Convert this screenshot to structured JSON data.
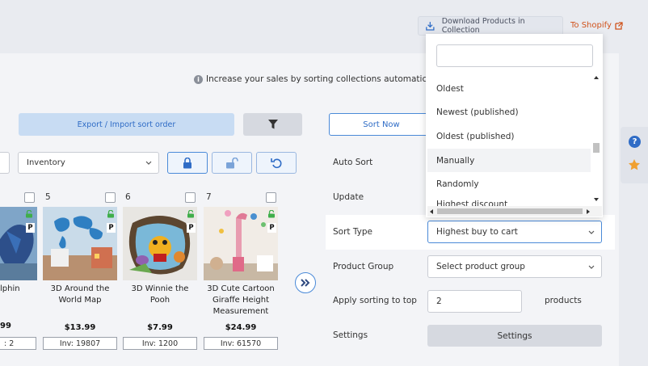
{
  "header": {
    "download_label": "Download Products in Collection",
    "shopify_label": "To Shopify"
  },
  "info_text": "Increase your sales by sorting collections automatically b",
  "toolbar": {
    "export_label": "Export / Import sort order",
    "sort_now_label": "Sort Now",
    "inventory_select": "Inventory"
  },
  "products": [
    {
      "num": "",
      "name_lines": [
        "lphin"
      ],
      "price": "99",
      "inv": ": 2"
    },
    {
      "num": "5",
      "name_lines": [
        "3D Around the",
        "World Map"
      ],
      "price": "$13.99",
      "inv": "Inv: 19807"
    },
    {
      "num": "6",
      "name_lines": [
        "3D Winnie the",
        "Pooh"
      ],
      "price": "$7.99",
      "inv": "Inv: 1200"
    },
    {
      "num": "7",
      "name_lines": [
        "3D Cute Cartoon",
        "Giraffe Height",
        "Measurement"
      ],
      "price": "$24.99",
      "inv": "Inv: 61570"
    }
  ],
  "badge_p": "P",
  "form": {
    "auto_sort": "Auto Sort",
    "update": "Update",
    "sort_type": "Sort Type",
    "sort_type_value": "Highest buy to cart",
    "product_group": "Product Group",
    "product_group_value": "Select product group",
    "apply_top": "Apply sorting to top",
    "apply_top_value": "2",
    "products_label": "products",
    "settings": "Settings",
    "settings_button": "Settings"
  },
  "dropdown": {
    "search_value": "",
    "items": [
      "Oldest",
      "Newest (published)",
      "Oldest (published)",
      "Manually",
      "Randomly",
      "Highest discount"
    ],
    "highlighted_index": 3
  },
  "colors": {
    "accent": "#2f6cc6",
    "shopify": "#d0521b",
    "star": "#f0a030"
  }
}
